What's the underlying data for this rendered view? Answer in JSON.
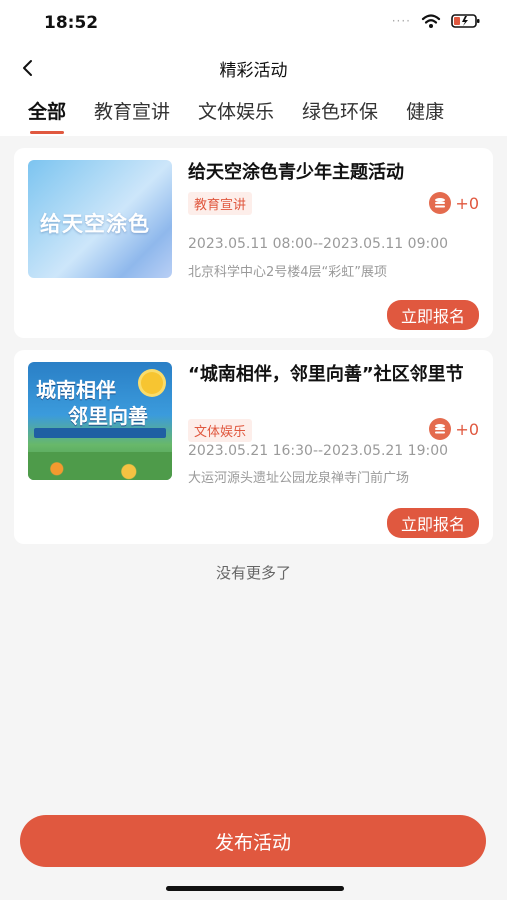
{
  "status": {
    "time": "18:52",
    "dots": "····"
  },
  "nav": {
    "title": "精彩活动"
  },
  "tabs": [
    "全部",
    "教育宣讲",
    "文体娱乐",
    "绿色环保",
    "健康"
  ],
  "activities": [
    {
      "thumb_text": "给天空涂色",
      "title": "给天空涂色青少年主题活动",
      "tag": "教育宣讲",
      "points": "+0",
      "time": "2023.05.11 08:00--2023.05.11 09:00",
      "place": "北京科学中心2号楼4层“彩虹”展项",
      "button": "立即报名"
    },
    {
      "thumb_text_1": "城南相伴",
      "thumb_text_2": "邻里向善",
      "title": "“城南相伴，邻里向善”社区邻里节",
      "tag": "文体娱乐",
      "points": "+0",
      "time": "2023.05.21 16:30--2023.05.21 19:00",
      "place": "大运河源头遗址公园龙泉禅寺门前广场",
      "button": "立即报名"
    }
  ],
  "footer": {
    "no_more": "没有更多了",
    "publish": "发布活动"
  },
  "colors": {
    "accent": "#e0583f",
    "tag_bg": "#fdeeea"
  }
}
